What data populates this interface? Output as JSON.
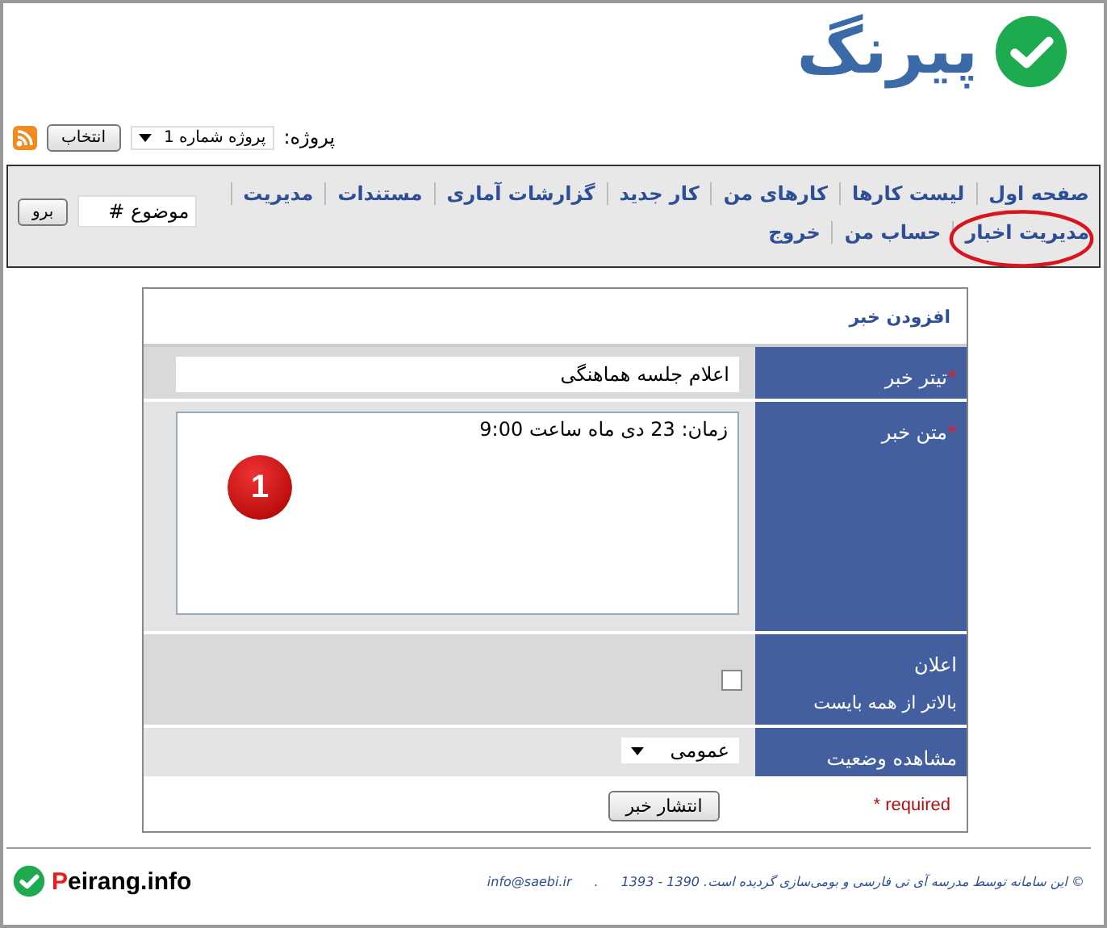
{
  "logo": {
    "text": "پیرنگ"
  },
  "project_bar": {
    "label": "پروژه:",
    "project": "پروژه شماره 1",
    "select_button": "انتخاب"
  },
  "nav": {
    "items": [
      "صفحه اول",
      "لیست کارها",
      "کارهای من",
      "کار جدید",
      "گزارشات آماری",
      "مستندات",
      "مدیریت",
      "مدیریت اخبار",
      "حساب من",
      "خروج"
    ],
    "search": {
      "value": "موضوع #",
      "button": "برو"
    }
  },
  "annotation": {
    "badge": "1"
  },
  "form": {
    "title": "افزودن خبر",
    "rows": [
      {
        "kind": "text",
        "label": "تیتر خبر",
        "required": true,
        "value": "اعلام جلسه هماهنگی"
      },
      {
        "kind": "textarea",
        "label": "متن خبر",
        "required": true,
        "value": "زمان: 23 دی ماه ساعت 9:00"
      },
      {
        "kind": "checkbox",
        "label": "اعلان",
        "hint": "بالاتر از همه بایست",
        "required": false,
        "checked": false
      },
      {
        "kind": "select",
        "label": "مشاهده وضعیت",
        "required": false,
        "value": "عمومی"
      }
    ],
    "required_note": "* required",
    "required_mark": "*",
    "submit": "انتشار خبر"
  },
  "footer": {
    "brand_initial": "P",
    "brand_rest": "eirang.info",
    "copyright": "© این سامانه توسط مدرسه آی تی فارسی و بومی‌سازی گردیده است. 1390 - 1393",
    "separator": ".",
    "email": "info@saebi.ir"
  }
}
